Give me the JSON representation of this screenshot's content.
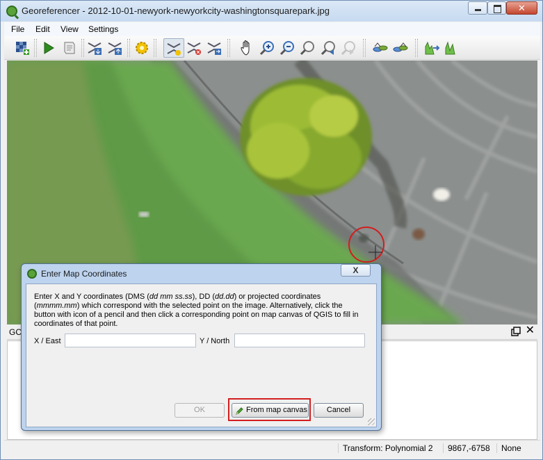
{
  "window": {
    "title": "Georeferencer - 2012-10-01-newyork-newyorkcity-washingtonsquarepark.jpg",
    "app_icon": "qgis-icon",
    "controls": [
      "minimize-icon",
      "maximize-icon",
      "close-icon"
    ]
  },
  "menubar": {
    "items": [
      "File",
      "Edit",
      "View",
      "Settings"
    ]
  },
  "toolbar": {
    "buttons": [
      "open-raster-icon",
      "start-georeferencing-icon",
      "generate-gdal-script-icon",
      "load-gcp-points-icon",
      "save-gcp-points-icon",
      "transformation-settings-icon",
      "add-point-icon",
      "delete-point-icon",
      "move-gcp-point-icon",
      "pan-icon",
      "zoom-in-icon",
      "zoom-out-icon",
      "zoom-to-layer-icon",
      "zoom-last-icon",
      "zoom-next-icon",
      "link-georeferencer-to-qgis-icon",
      "link-qgis-to-georeferencer-icon",
      "full-histogram-stretch-icon",
      "local-histogram-stretch-icon"
    ],
    "active": "add-point-icon"
  },
  "dock": {
    "title": "GC",
    "float_icon": "float-icon",
    "close_icon": "close-icon"
  },
  "statusbar": {
    "transform": "Transform: Polynomial 2",
    "coords": "9867,-6758",
    "crs": "None"
  },
  "dialog": {
    "title": "Enter Map Coordinates",
    "close_label": "X",
    "instructions": {
      "p1": "Enter X and Y coordinates (DMS (",
      "dms": "dd mm ss.ss",
      "p2": "), DD (",
      "dd": "dd.dd",
      "p3": ") or projected coordinates (",
      "proj": "mmmm.mm",
      "p4": ") which correspond with the selected point on the image. Alternatively, click the button with icon of a pencil and then click a corresponding point on map canvas of QGIS to fill in coordinates of that point."
    },
    "x_label": "X / East",
    "x_value": "",
    "y_label": "Y / North",
    "y_value": "",
    "ok_label": "OK",
    "map_label": "From map canvas",
    "cancel_label": "Cancel"
  },
  "colors": {
    "highlight": "#d21e1e",
    "gcp_circle": "#d21e1e",
    "grass": "#6aa84f",
    "pavement": "#8e9190"
  }
}
